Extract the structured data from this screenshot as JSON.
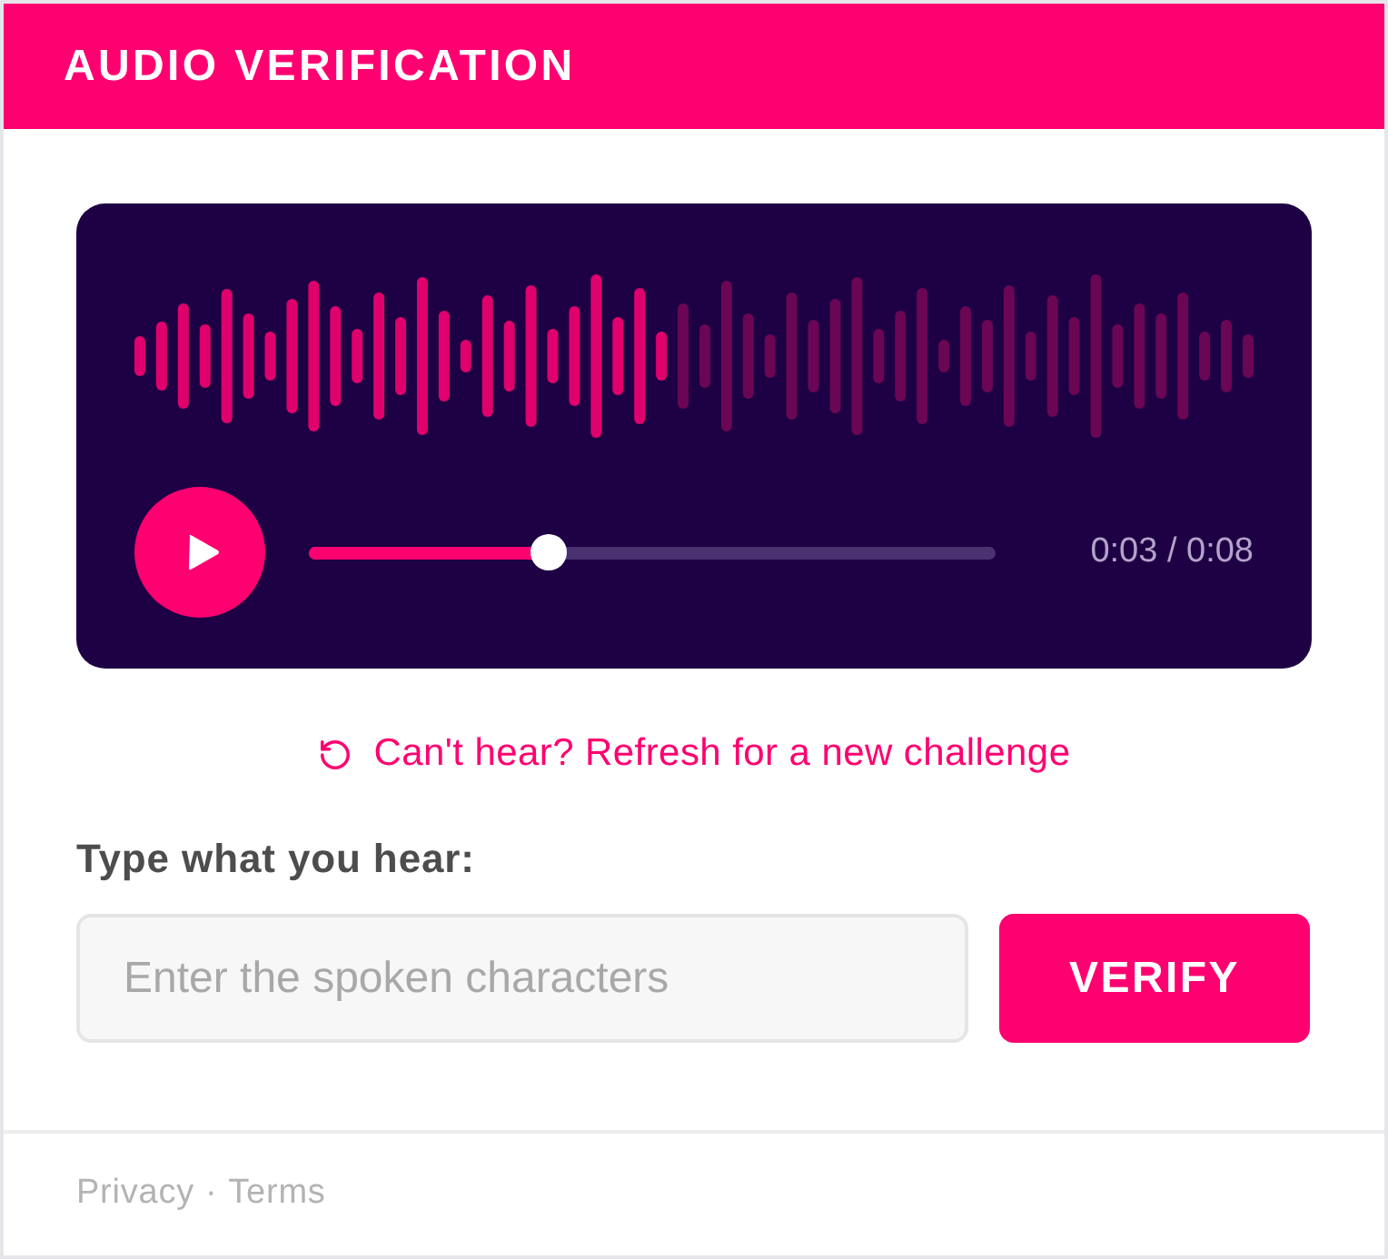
{
  "header": {
    "title": "AUDIO VERIFICATION"
  },
  "player": {
    "playing": false,
    "progress": {
      "level": 0.35
    },
    "time": "0:03 / 0:08"
  },
  "refresh_link": {
    "label": "Can't hear? Refresh for a new challenge"
  },
  "answer": {
    "label": "Type what you hear:",
    "placeholder": "Enter the spoken characters"
  },
  "verify_button": {
    "label": "VERIFY"
  },
  "footer": {
    "links": [
      "Privacy",
      "Terms"
    ],
    "separator": "·"
  }
}
